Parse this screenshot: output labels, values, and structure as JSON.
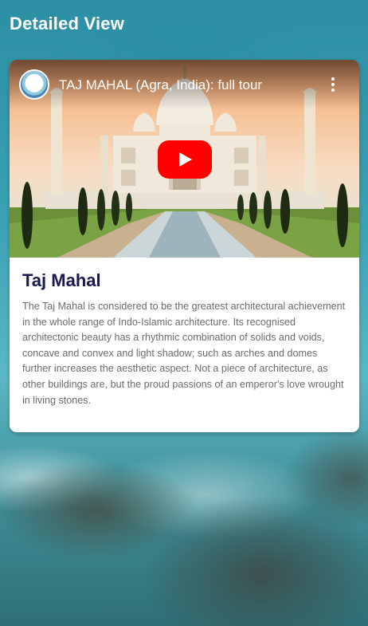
{
  "header": {
    "title": "Detailed View"
  },
  "video": {
    "title": "TAJ MAHAL (Agra, India): full tour",
    "channel_icon": "channel-logo",
    "menu_icon": "more-vertical-icon",
    "play_icon": "youtube-play-icon"
  },
  "place": {
    "name": "Taj Mahal",
    "description": "The Taj Mahal is considered to be the greatest architectural achievement in the whole range of Indo-Islamic architecture. Its recognised architectonic beauty has a rhythmic combination of solids and voids, concave and convex and light shadow; such as arches and domes further increases the aesthetic aspect. Not a piece of architecture, as other buildings are, but the proud passions of an emperor's love wrought in living stones."
  },
  "colors": {
    "title_text": "#161a4e",
    "body_text": "#6b6b6b",
    "play_red": "#ff0000"
  }
}
